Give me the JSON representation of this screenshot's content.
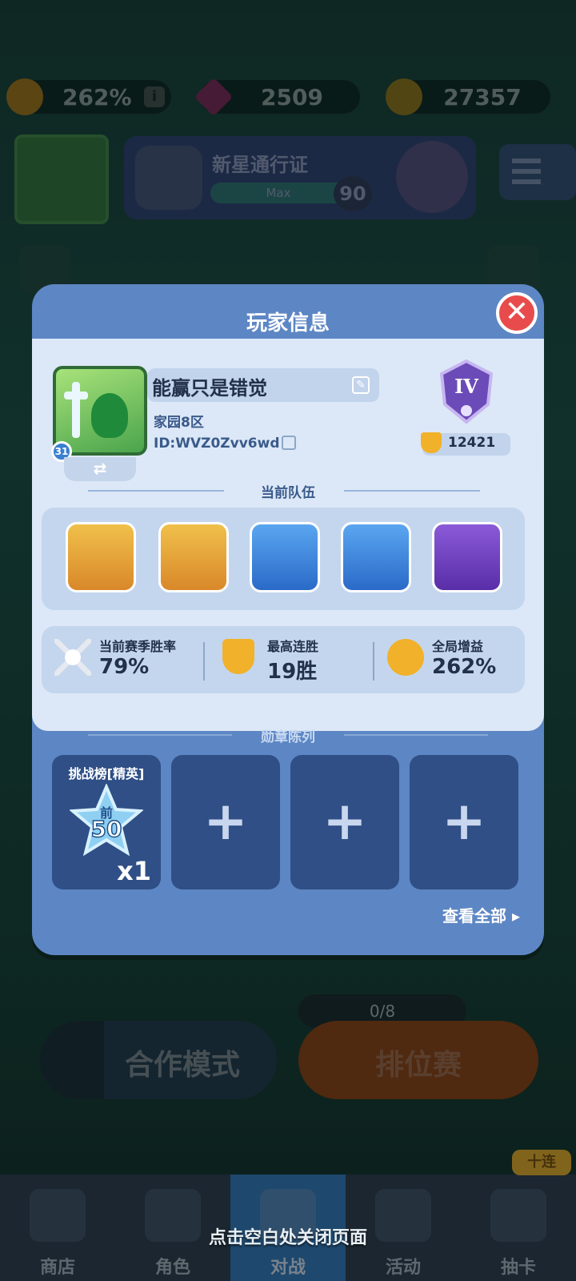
{
  "hud": {
    "boost_value": "262%",
    "gems_value": "2509",
    "coins_value": "27357",
    "info_glyph": "i"
  },
  "pass": {
    "title": "新星通行证",
    "bar_label": "Max",
    "level": "90"
  },
  "modes": {
    "coop_label": "合作模式",
    "ranked_label": "排位赛",
    "ranked_progress": "0/8"
  },
  "nav": {
    "items": [
      {
        "label": "商店"
      },
      {
        "label": "角色"
      },
      {
        "label": "对战"
      },
      {
        "label": "活动"
      },
      {
        "label": "抽卡"
      }
    ],
    "ten_pull_badge": "十连"
  },
  "hint": "点击空白处关闭页面",
  "modal": {
    "title": "玩家信息",
    "close_glyph": "✕",
    "player": {
      "name": "能赢只是错觉",
      "region": "家园8区",
      "id": "ID:WVZ0Zvv6wd",
      "level": "31",
      "swap_glyph": "⇄",
      "rank_numeral": "IV",
      "trophies": "12421"
    },
    "team_title": "当前队伍",
    "stats": [
      {
        "label": "当前赛季胜率",
        "value": "79%"
      },
      {
        "label": "最高连胜",
        "value": "19胜"
      },
      {
        "label": "全局增益",
        "value": "262%"
      }
    ],
    "medals_title": "勋章陈列",
    "medal": {
      "label": "挑战榜[精英]",
      "prefix": "前",
      "rank": "50",
      "count": "x1"
    },
    "add_glyph": "+",
    "view_all": "查看全部 ▸"
  },
  "colors": {
    "modal_blue": "#5d86c4",
    "panel_light": "#dce8f7",
    "close_red": "#e84b4b",
    "gold": "#f1b12a"
  }
}
